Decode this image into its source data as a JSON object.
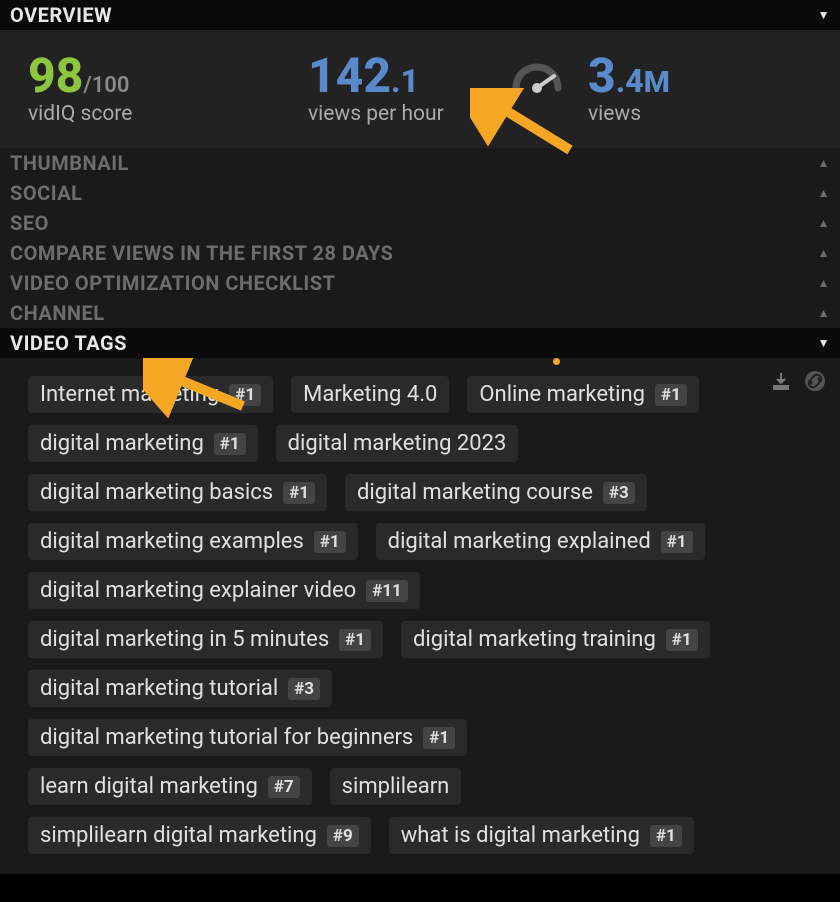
{
  "sections": {
    "overview": "OVERVIEW",
    "thumbnail": "THUMBNAIL",
    "social": "SOCIAL",
    "seo": "SEO",
    "compare": "COMPARE VIEWS IN THE FIRST 28 DAYS",
    "checklist": "VIDEO OPTIMIZATION CHECKLIST",
    "channel": "CHANNEL",
    "videotags": "VIDEO TAGS"
  },
  "overview": {
    "score": {
      "value": "98",
      "denom": "/100",
      "label": "vidIQ score"
    },
    "vph": {
      "main": "142",
      "dec": ".1",
      "label": "views per hour"
    },
    "views": {
      "main": "3",
      "dec": ".4",
      "unit": "M",
      "label": "views"
    }
  },
  "tags": [
    {
      "text": "Internet marketing",
      "rank": "#1"
    },
    {
      "text": "Marketing 4.0",
      "rank": null
    },
    {
      "text": "Online marketing",
      "rank": "#1"
    },
    {
      "text": "digital marketing",
      "rank": "#1"
    },
    {
      "text": "digital marketing 2023",
      "rank": null
    },
    {
      "text": "digital marketing basics",
      "rank": "#1"
    },
    {
      "text": "digital marketing course",
      "rank": "#3"
    },
    {
      "text": "digital marketing examples",
      "rank": "#1"
    },
    {
      "text": "digital marketing explained",
      "rank": "#1"
    },
    {
      "text": "digital marketing explainer video",
      "rank": "#11"
    },
    {
      "text": "digital marketing in 5 minutes",
      "rank": "#1"
    },
    {
      "text": "digital marketing training",
      "rank": "#1"
    },
    {
      "text": "digital marketing tutorial",
      "rank": "#3"
    },
    {
      "text": "digital marketing tutorial for beginners",
      "rank": "#1"
    },
    {
      "text": "learn digital marketing",
      "rank": "#7"
    },
    {
      "text": "simplilearn",
      "rank": null
    },
    {
      "text": "simplilearn digital marketing",
      "rank": "#9"
    },
    {
      "text": "what is digital marketing",
      "rank": "#1"
    }
  ]
}
